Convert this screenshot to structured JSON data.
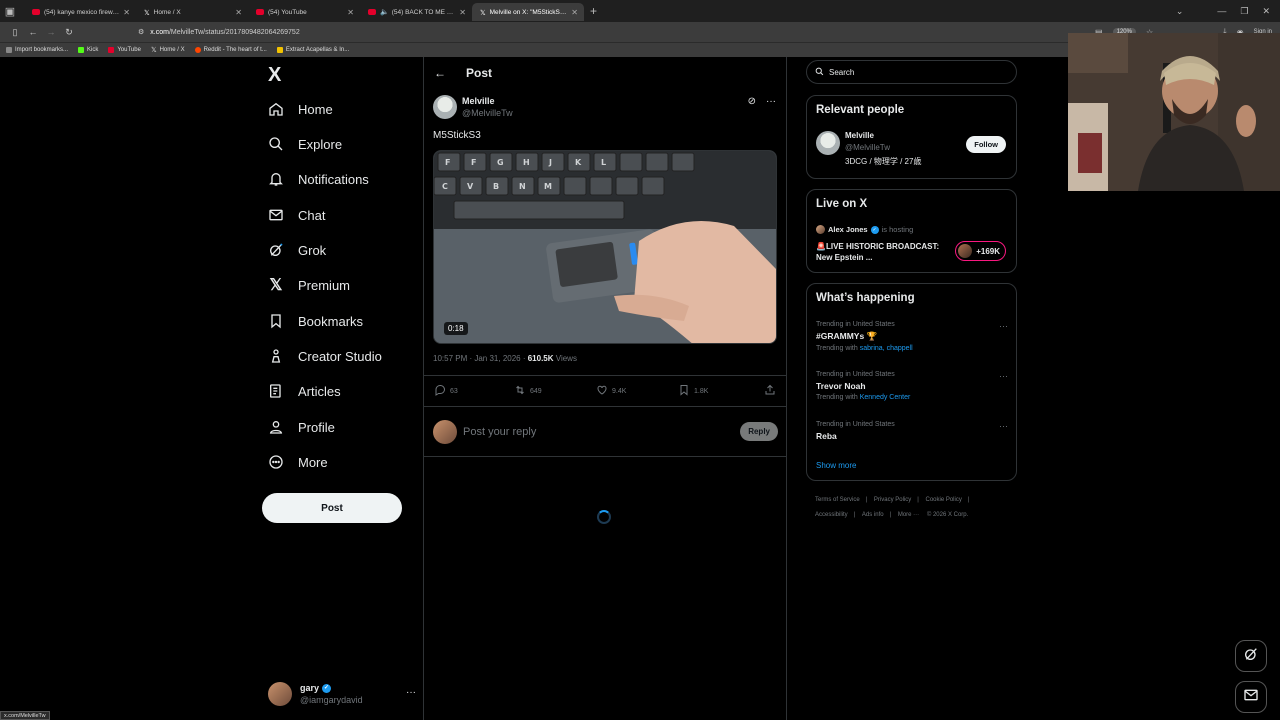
{
  "browser": {
    "tabs": [
      {
        "title": "(54) kanye mexico fireworks - Y",
        "color": "#e4002b",
        "active": false
      },
      {
        "title": "Home / X",
        "color": "#000000",
        "active": false
      },
      {
        "title": "(54) YouTube",
        "color": "#e4002b",
        "active": false
      },
      {
        "title": "(54) BACK TO ME - YouTub",
        "color": "#e4002b",
        "active": false
      },
      {
        "title": "Melville on X: \"M5StickS3 https:",
        "color": "#000000",
        "active": true
      }
    ],
    "new_tab": "+",
    "url_host": "x.com",
    "url_path": "/MelvilleTw/status/2017809482064269752",
    "zoom": "120%",
    "sign_in": "Sign in",
    "bookmarks": [
      {
        "label": "Import bookmarks...",
        "color": "#888888"
      },
      {
        "label": "Kick",
        "color": "#53fc18"
      },
      {
        "label": "YouTube",
        "color": "#e4002b"
      },
      {
        "label": "Home / X",
        "color": "#ffffff"
      },
      {
        "label": "Reddit - The heart of t...",
        "color": "#ff4500"
      },
      {
        "label": "Extract Acapellas & In...",
        "color": "#f2c200"
      }
    ],
    "status_url": "x.com/MelvilleTw"
  },
  "nav": {
    "logo": "X",
    "items": [
      {
        "label": "Home",
        "icon": "home-icon"
      },
      {
        "label": "Explore",
        "icon": "search-icon"
      },
      {
        "label": "Notifications",
        "icon": "bell-icon"
      },
      {
        "label": "Chat",
        "icon": "mail-icon"
      },
      {
        "label": "Grok",
        "icon": "grok-icon"
      },
      {
        "label": "Premium",
        "icon": "x-icon"
      },
      {
        "label": "Bookmarks",
        "icon": "bookmark-icon"
      },
      {
        "label": "Creator Studio",
        "icon": "creator-icon"
      },
      {
        "label": "Articles",
        "icon": "article-icon"
      },
      {
        "label": "Profile",
        "icon": "person-icon"
      },
      {
        "label": "More",
        "icon": "more-circle-icon"
      }
    ],
    "post_button": "Post",
    "account": {
      "name": "gary",
      "handle": "@iamgarydavid"
    }
  },
  "main": {
    "title": "Post",
    "author": {
      "name": "Melville",
      "handle": "@MelvilleTw"
    },
    "text": "M5StickS3",
    "video_duration": "0:18",
    "timestamp": "10:57 PM · Jan 31, 2026 · ",
    "views_count": "610.5K",
    "views_label": " Views",
    "stats": {
      "replies": "63",
      "reposts": "649",
      "likes": "9.4K",
      "bookmarks": "1.8K"
    },
    "reply_placeholder": "Post your reply",
    "reply_button": "Reply"
  },
  "sidebar": {
    "search_placeholder": "Search",
    "relevant": {
      "title": "Relevant people",
      "name": "Melville",
      "handle": "@MelvilleTw",
      "bio": "3DCG / 物理学 / 27歳",
      "follow": "Follow"
    },
    "live": {
      "title": "Live on X",
      "host": "Alex Jones",
      "host_suffix": "is hosting",
      "broadcast": "🚨LIVE HISTORIC BROADCAST: New Epstein ...",
      "count": "+169K"
    },
    "happening": {
      "title": "What’s happening",
      "trends": [
        {
          "context": "Trending in United States",
          "name": "#GRAMMYs",
          "with_label": "Trending with ",
          "with_links": "sabrina, chappell"
        },
        {
          "context": "Trending in United States",
          "name": "Trevor Noah",
          "with_label": "Trending with ",
          "with_links": "Kennedy Center"
        },
        {
          "context": "Trending in United States",
          "name": "Reba",
          "with_label": "",
          "with_links": ""
        }
      ],
      "show_more": "Show more"
    },
    "footer": {
      "terms": "Terms of Service",
      "privacy": "Privacy Policy",
      "cookie": "Cookie Policy",
      "accessibility": "Accessibility",
      "ads": "Ads info",
      "more": "More ···",
      "copyright": "© 2026 X Corp."
    }
  },
  "colors": {
    "accent": "#1d9bf0",
    "live": "#f91880",
    "background": "#000000"
  }
}
